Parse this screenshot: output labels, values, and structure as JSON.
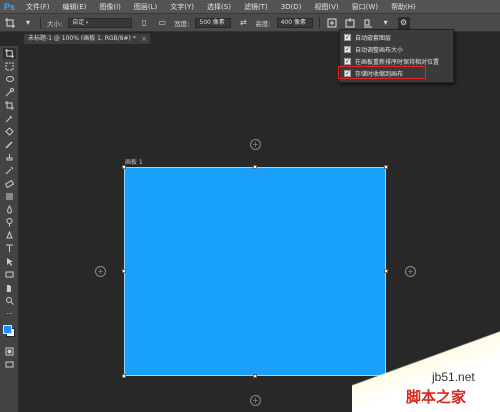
{
  "app": {
    "logo_text": "Ps"
  },
  "menu": [
    "文件(F)",
    "编辑(E)",
    "图像(I)",
    "图层(L)",
    "文字(Y)",
    "选择(S)",
    "滤镜(T)",
    "3D(D)",
    "视图(V)",
    "窗口(W)",
    "帮助(H)"
  ],
  "options_bar": {
    "size_label": "大小:",
    "size_value": "自定",
    "width_label": "宽度:",
    "width_value": "500 像素",
    "height_label": "高度:",
    "height_value": "400 像素"
  },
  "document_tab": {
    "title": "未标题-1 @ 100% (画板 1, RGB/8#) *",
    "close": "×"
  },
  "artboard": {
    "name": "画板 1",
    "fill_color": "#18a0fb"
  },
  "dropdown": {
    "items": [
      {
        "label": "自动嵌套图层",
        "checked": true
      },
      {
        "label": "自动调整画布大小",
        "checked": true
      },
      {
        "label": "在画板重新排序时保持相对位置",
        "checked": true
      },
      {
        "label": "存储时收缩到画布",
        "checked": true,
        "highlighted": true
      }
    ],
    "highlight_color": "#e02626"
  },
  "watermark": {
    "site": "jb51.net",
    "name": "脚本之家"
  },
  "colors": {
    "foreground": "#1e90ff",
    "background": "#ffffff",
    "accent": "#31a8ff"
  }
}
